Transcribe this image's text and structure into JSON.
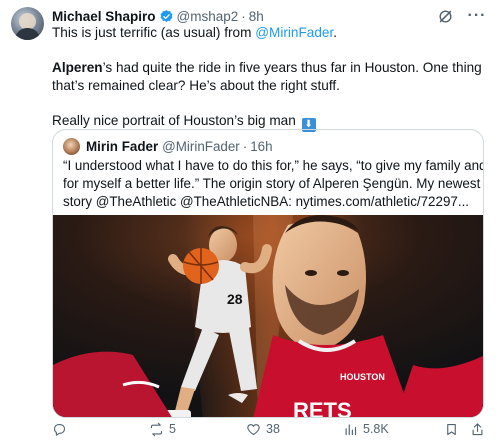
{
  "tweet": {
    "author_name": "Michael Shapiro",
    "author_handle": "@mshap2",
    "separator": "·",
    "time": "8h",
    "more": "···",
    "line1_prefix": "This is just terrific (as usual) from ",
    "line1_mention": "@MirinFader",
    "line1_suffix": ".",
    "line2_bold": "Alperen",
    "line2_rest": "’s had quite the ride in five years thus far in Houston. One thing",
    "line3": "that’s remained clear? He’s about the right stuff.",
    "line4": "Really nice portrait of Houston’s big man",
    "emoji": "⬇"
  },
  "quote": {
    "author_name": "Mirin Fader",
    "author_handle": "@MirinFader",
    "separator": "·",
    "time": "16h",
    "line1": "“I understood what I have to do this for,” he says, “to give my family and",
    "line2": "for myself a better life.” The origin story of Alperen Şengün. My newest",
    "line3": "story @TheAthletic @TheAthleticNBA: nytimes.com/athletic/72297...",
    "image_jersey_number": "28",
    "image_jersey_text": "HOUSTON",
    "image_bottom_text": "RETS"
  },
  "actions": {
    "replies": "",
    "reposts": "5",
    "likes": "38",
    "views": "5.8K"
  },
  "colors": {
    "accent": "#1d9bf0",
    "text": "#0f1419",
    "muted": "#536471",
    "rockets_red": "#ce1141"
  }
}
